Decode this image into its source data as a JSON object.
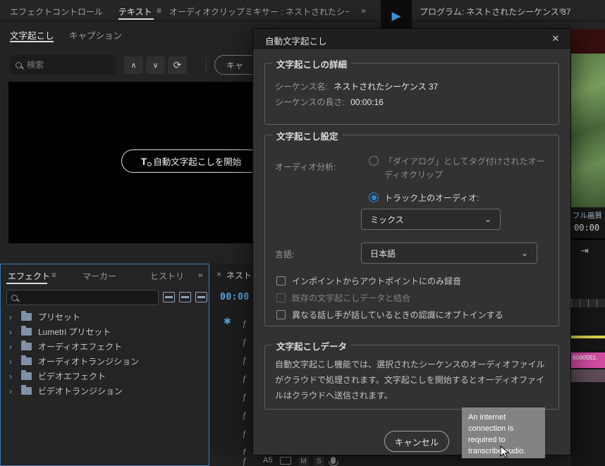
{
  "icons": {
    "panel_menu": "≡",
    "overflow": "»",
    "chevron_up": "∧",
    "chevron_down": "∨",
    "refresh": "⟳",
    "close": "✕",
    "dropdown": "⌄",
    "tree_chevron": "›",
    "play": "▶",
    "snap": "✱",
    "fx": "ƒ",
    "skip": "⇥",
    "tab_close": "×",
    "transcribe": "T"
  },
  "topbar": {
    "tab_effect_controls": "エフェクトコントロール",
    "tab_text": "テキスト",
    "tab_audio_mixer": "オーディオクリップミキサー : ネストされたシーケ",
    "program_label": "プログラム: ネストされたシーケンス 37"
  },
  "text_panel": {
    "tab_transcript": "文字起こし",
    "tab_captions": "キャプション",
    "search_placeholder": "検索",
    "caption_button_partial": "キャ",
    "start_button": "自動文字起こしを開始"
  },
  "effects_panel": {
    "tab_effects": "エフェクト",
    "tab_markers": "マーカー",
    "tab_history": "ヒストリ",
    "items": [
      "プリセット",
      "Lumetri プリセット",
      "オーディオエフェクト",
      "オーディオトランジション",
      "ビデオエフェクト",
      "ビデオトランジション"
    ]
  },
  "timeline": {
    "tab_label": "ネスト...",
    "timecode": "00:00",
    "track_label": "A5",
    "mute": "M",
    "solo": "S"
  },
  "program": {
    "quality": "フル画質",
    "timecode": "00:00",
    "clip_label": "6090551."
  },
  "dialog": {
    "title": "自動文字起こし",
    "details": {
      "legend": "文字起こしの詳細",
      "name_label": "シーケンス名:",
      "name_value": "ネストされたシーケンス 37",
      "length_label": "シーケンスの長さ:",
      "length_value": "00:00:16"
    },
    "settings": {
      "legend": "文字起こし設定",
      "audio_label": "オーディオ分析:",
      "radio_dialog": "「ダイアログ」としてタグ付けされたオーディオクリップ",
      "radio_track": "トラック上のオーディオ:",
      "track_value": "ミックス",
      "language_label": "言語:",
      "language_value": "日本語",
      "check_in_out": "インポイントからアウトポイントにのみ録音",
      "check_merge": "既存の文字起こしデータと結合",
      "check_speakers": "異なる話し手が話しているときの認識にオプトインする"
    },
    "data": {
      "legend": "文字起こしデータ",
      "body": "自動文字起こし機能では、選択されたシーケンスのオーディオファイルがクラウドで処理されます。文字起こしを開始するとオーディオファイルはクラウドへ送信されます。"
    },
    "cancel": "キャンセル"
  },
  "tooltip": {
    "text": "An internet connection is required to transcribe audio."
  },
  "colors": {
    "accent_blue": "#2e86d6",
    "timecode_blue": "#53ace8",
    "clip_yellow": "#d9d44c",
    "clip_pink": "#d44da3"
  }
}
